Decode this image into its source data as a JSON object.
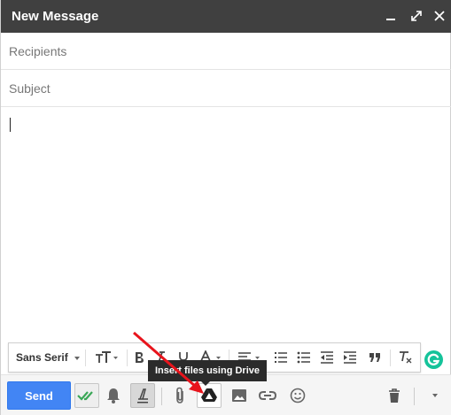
{
  "window": {
    "title": "New Message"
  },
  "fields": {
    "recipients_placeholder": "Recipients",
    "subject_placeholder": "Subject"
  },
  "formatting": {
    "font_label": "Sans Serif"
  },
  "bottom": {
    "send_label": "Send"
  },
  "tooltip": {
    "text": "Insert files using Drive"
  },
  "colors": {
    "titlebar": "#404040",
    "send_button": "#4285f4",
    "grammarly": "#15c39a",
    "annotation_arrow": "#e8141c",
    "check_green": "#3aa757"
  },
  "icons": [
    "minimize-icon",
    "popout-icon",
    "close-icon",
    "font-size-icon",
    "bold-icon",
    "italic-icon",
    "underline-icon",
    "text-color-icon",
    "align-icon",
    "numbered-list-icon",
    "bulleted-list-icon",
    "indent-less-icon",
    "indent-more-icon",
    "quote-icon",
    "remove-formatting-icon",
    "grammarly-icon",
    "checkmark-icon",
    "bell-icon",
    "formatting-toggle-icon",
    "attach-icon",
    "drive-icon",
    "photo-icon",
    "link-icon",
    "emoji-icon",
    "trash-icon",
    "more-options-icon"
  ]
}
